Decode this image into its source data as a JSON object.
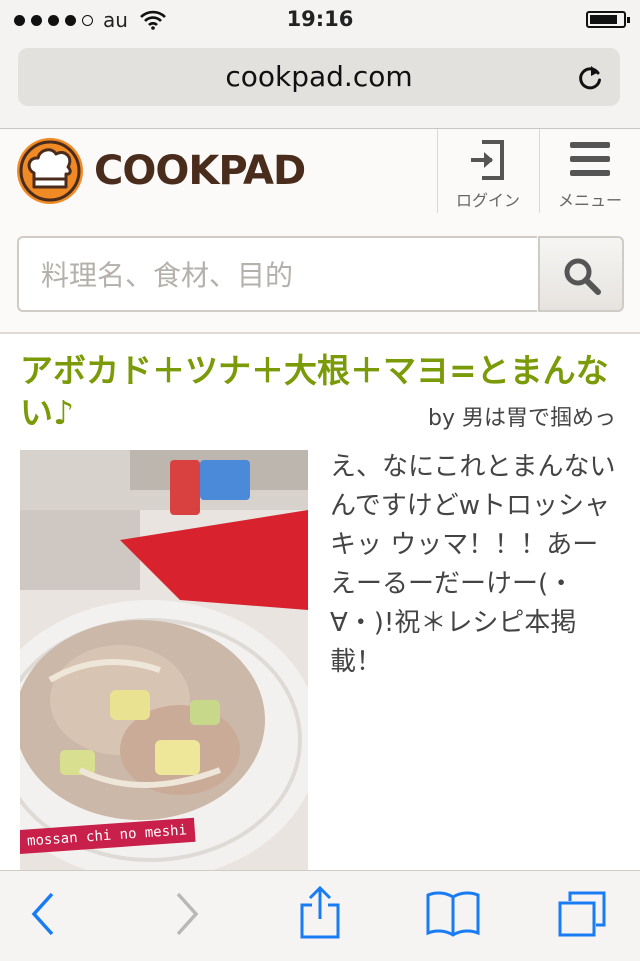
{
  "status_bar": {
    "carrier": "au",
    "time": "19:16",
    "signal_bars_filled": 4,
    "signal_bars_total": 5,
    "battery_level": 0.85
  },
  "browser": {
    "url": "cookpad.com"
  },
  "site_header": {
    "logo_text": "COOKPAD",
    "login_label": "ログイン",
    "menu_label": "メニュー",
    "icons": [
      "chef-hat-icon",
      "login-icon",
      "hamburger-icon"
    ]
  },
  "search": {
    "placeholder": "料理名、食材、目的",
    "button_icon": "search-icon"
  },
  "recipe": {
    "title": "アボカド＋ツナ＋大根＋マヨ=とまんない♪",
    "author": "by 男は胃で掴めっ",
    "description": "え、なにこれとまんないんですけどwトロッシャキッ ウッマ！！！あーえーるーだーけー(・∀・)!祝＊レシピ本掲載！",
    "photo_caption": "mossan chi no meshi"
  },
  "toolbar": {
    "icons": [
      "back-icon",
      "forward-icon",
      "share-icon",
      "bookmarks-icon",
      "tabs-icon"
    ]
  },
  "colors": {
    "title_green": "#7a9a08",
    "logo_orange": "#f08a24",
    "logo_brown": "#4a2c1d",
    "ios_blue": "#1a7cf5"
  }
}
